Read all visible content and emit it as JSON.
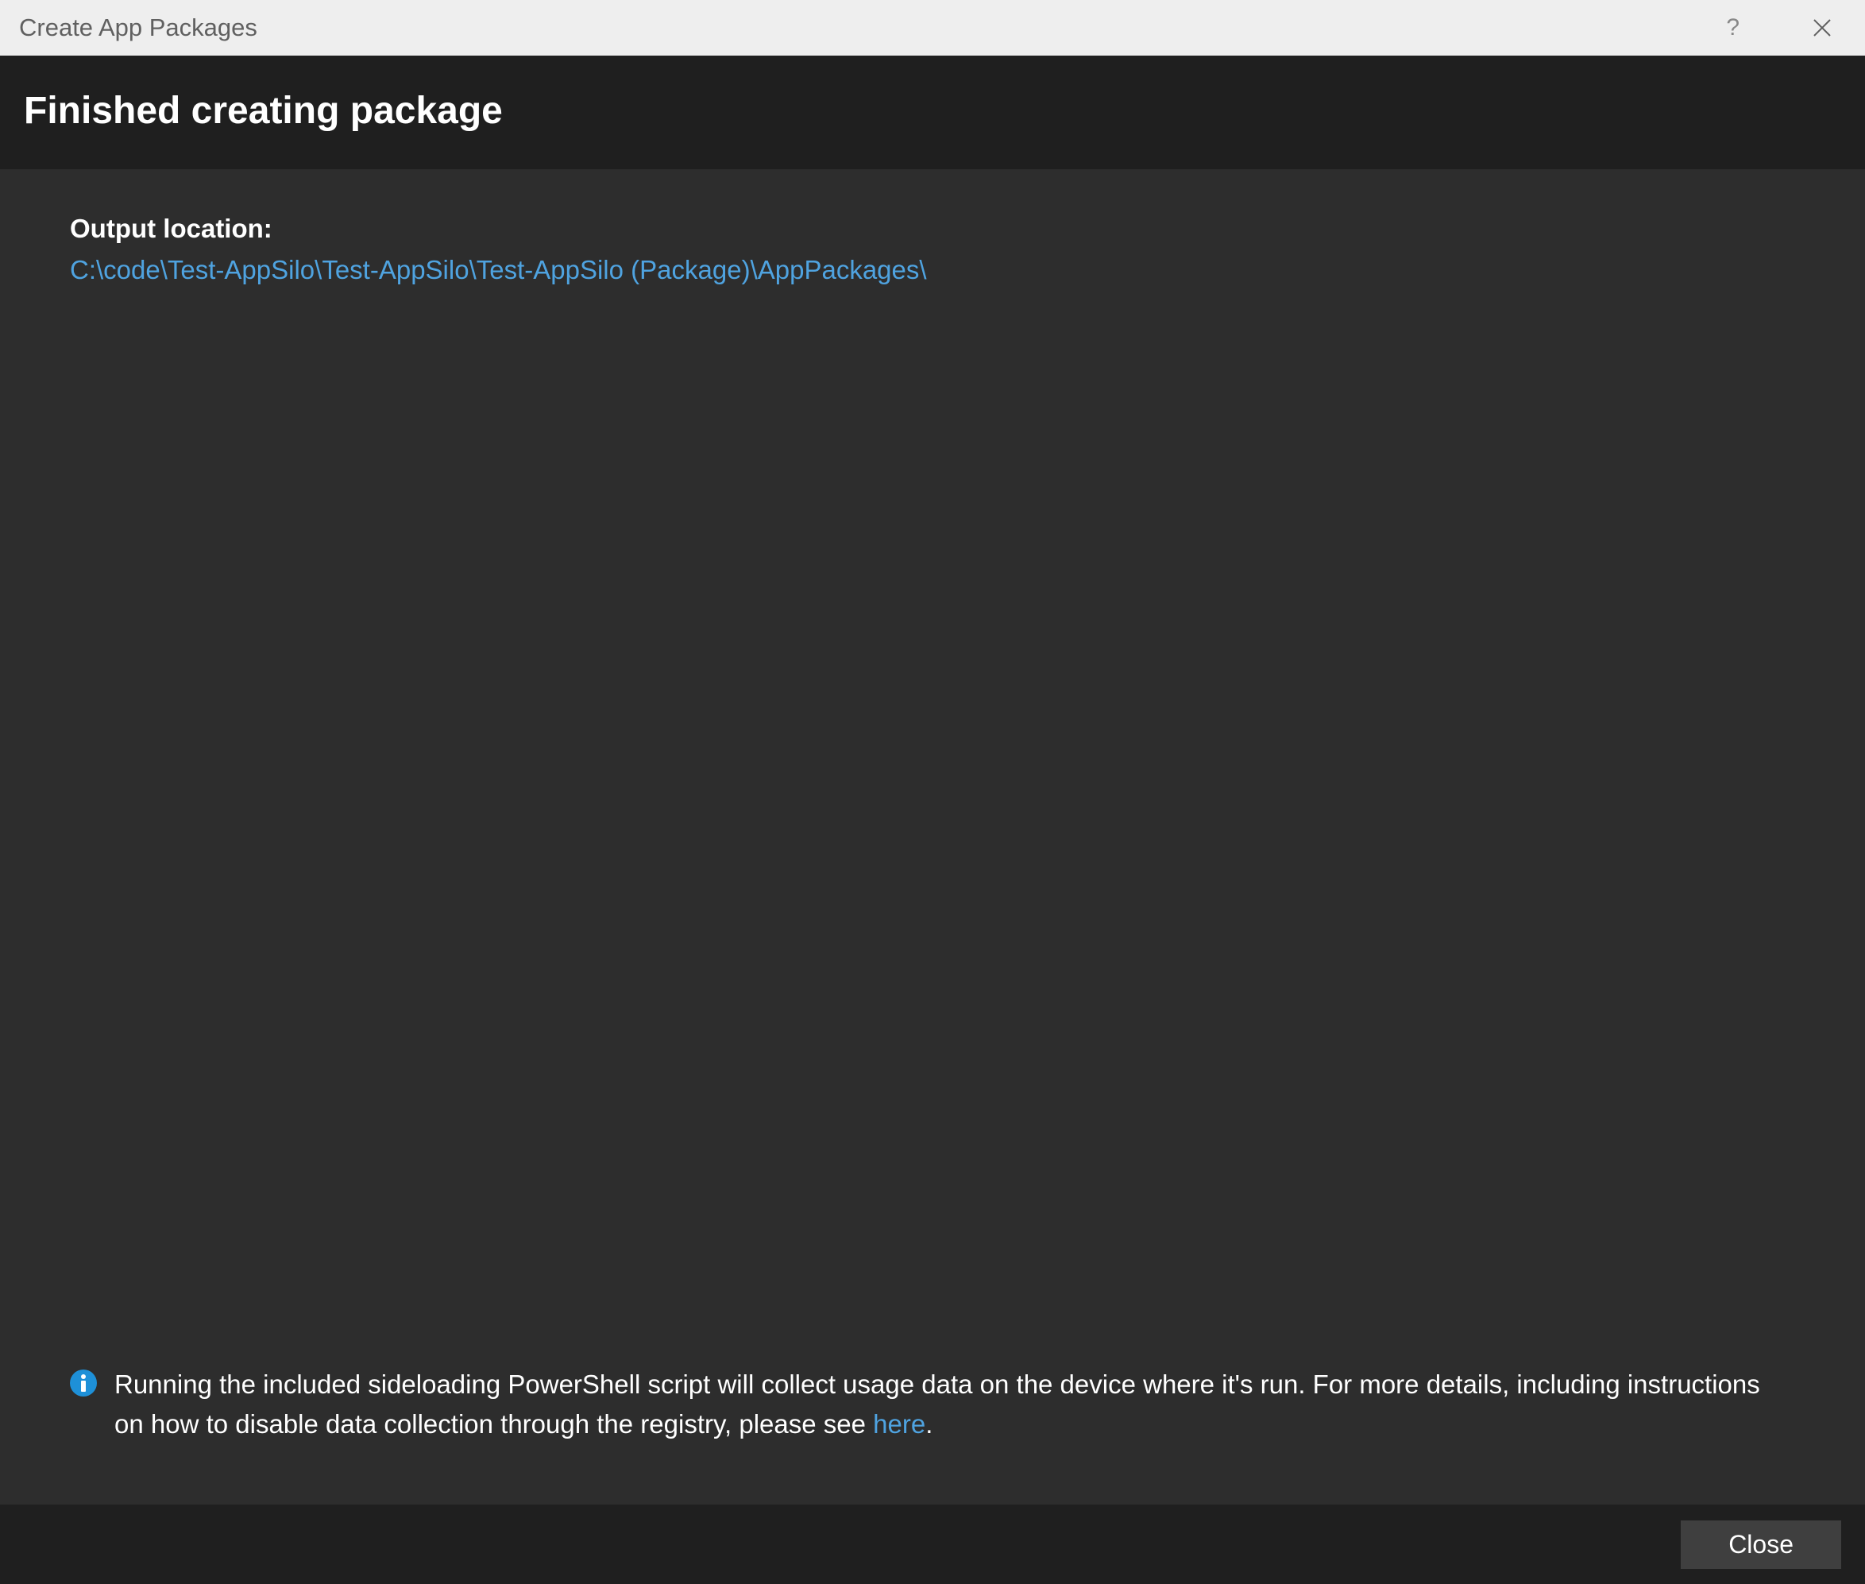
{
  "titlebar": {
    "title": "Create App Packages",
    "help_label": "?"
  },
  "heading": "Finished creating package",
  "output": {
    "label": "Output location:",
    "path": "C:\\code\\Test-AppSilo\\Test-AppSilo\\Test-AppSilo (Package)\\AppPackages\\"
  },
  "info": {
    "text_before": "Running the included sideloading PowerShell script will collect usage data on the device where it's run.  For more details, including instructions on how to disable data collection through the registry, please see  ",
    "link_label": "here",
    "text_after": "."
  },
  "footer": {
    "close_label": "Close"
  }
}
